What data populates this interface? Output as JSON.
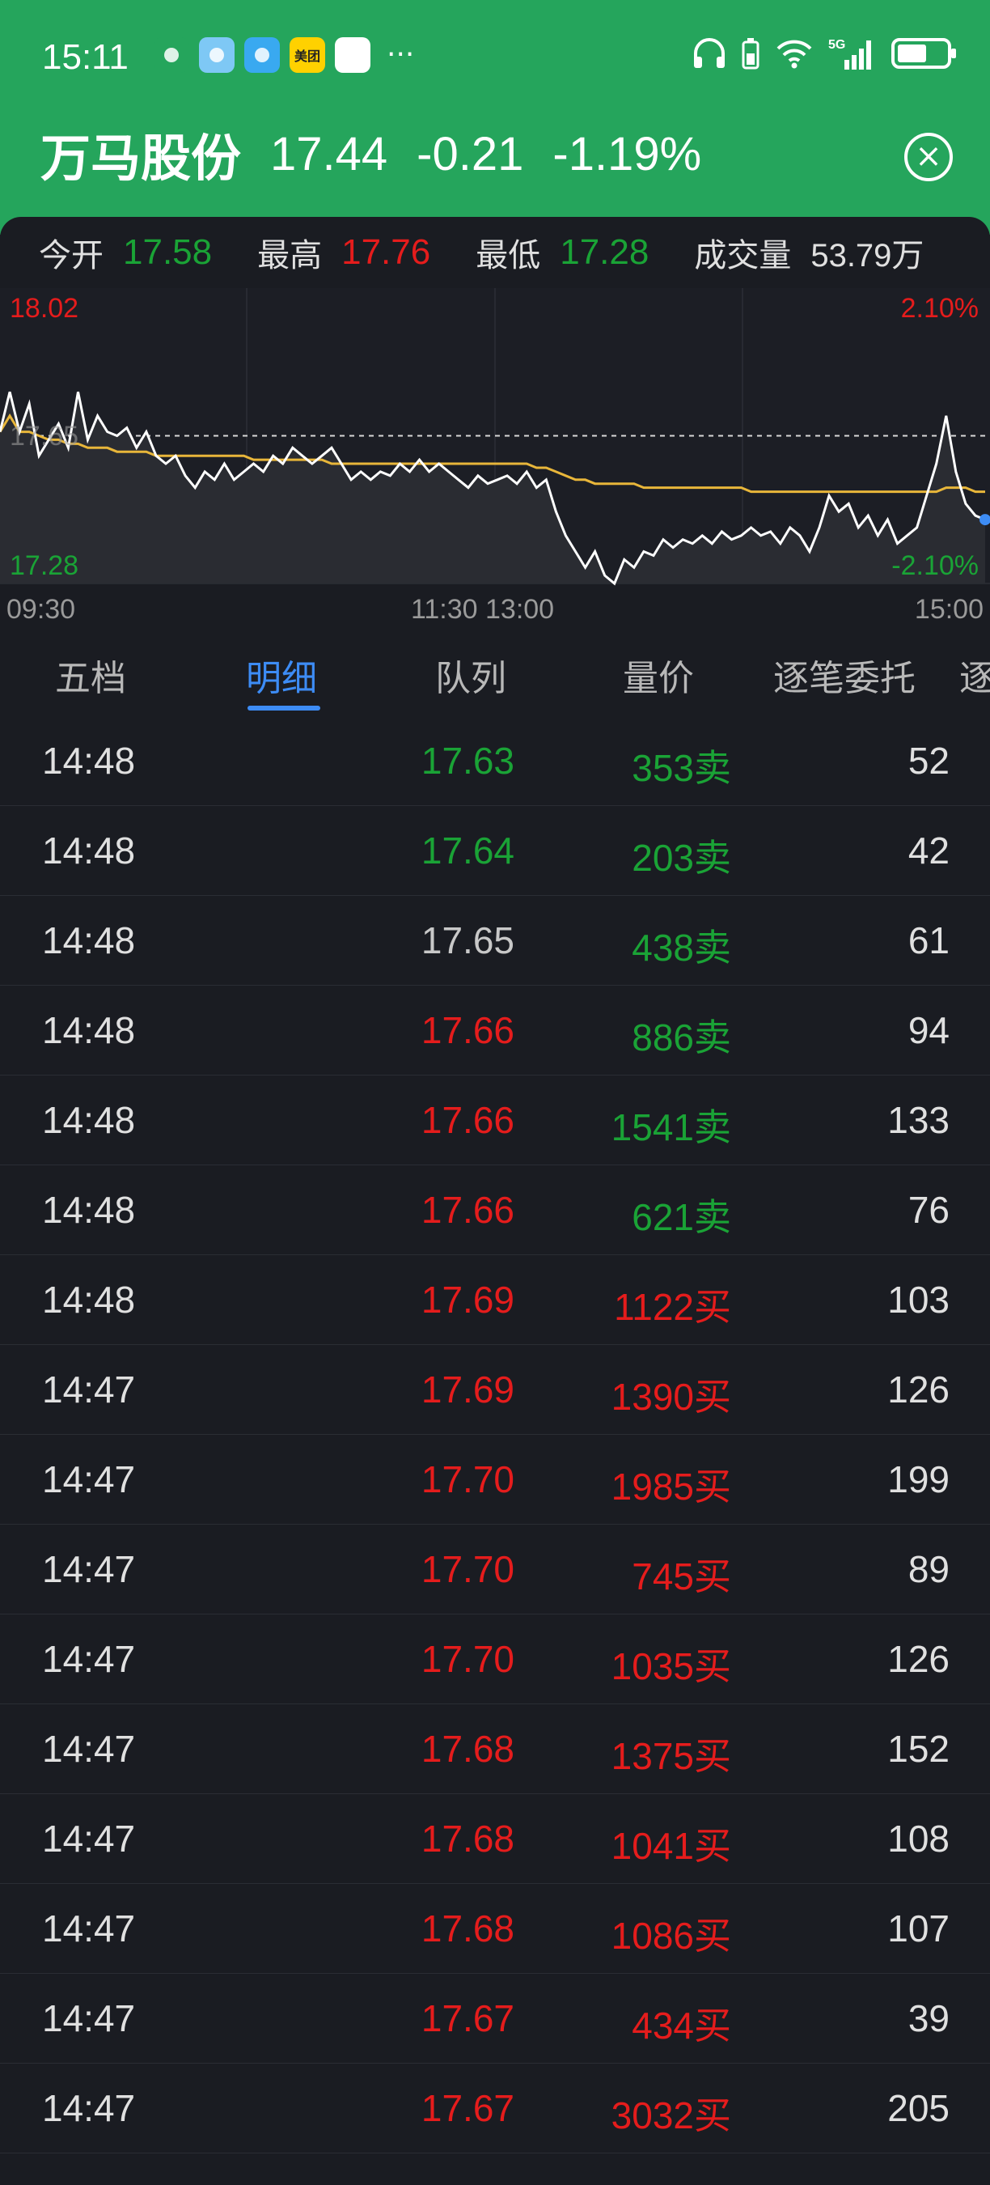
{
  "status": {
    "time": "15:11",
    "dots": "···",
    "network": "5G",
    "apps": [
      {
        "name": "wechat-icon",
        "label": "",
        "color": "#25a55c"
      },
      {
        "name": "weather-icon",
        "label": "",
        "color": "#7ec8f5"
      },
      {
        "name": "book-icon",
        "label": "",
        "color": "#39a9f0"
      },
      {
        "name": "meituan-icon",
        "label": "美团",
        "color": "#ffd100"
      },
      {
        "name": "browser-icon",
        "label": "",
        "color": "#ffffff"
      }
    ]
  },
  "stock": {
    "name": "万马股份",
    "price": "17.44",
    "change": "-0.21",
    "pct": "-1.19%"
  },
  "stats": {
    "open_label": "今开",
    "open": "17.58",
    "high_label": "最高",
    "high": "17.76",
    "low_label": "最低",
    "low": "17.28",
    "vol_label": "成交量",
    "vol": "53.79万"
  },
  "chart_data": {
    "type": "line",
    "y_max_label": "18.02",
    "y_min_label": "17.28",
    "y_mid_label": "17.65",
    "pct_max_label": "2.10%",
    "pct_min_label": "-2.10%",
    "x_labels": [
      "09:30",
      "11:30 13:00",
      "15:00"
    ],
    "ylim": [
      17.28,
      18.02
    ],
    "reference": 17.65,
    "series": [
      {
        "values": [
          17.66,
          17.76,
          17.66,
          17.73,
          17.6,
          17.64,
          17.68,
          17.62,
          17.76,
          17.64,
          17.7,
          17.66,
          17.65,
          17.67,
          17.62,
          17.66,
          17.6,
          17.58,
          17.6,
          17.55,
          17.52,
          17.56,
          17.54,
          17.58,
          17.54,
          17.56,
          17.58,
          17.56,
          17.6,
          17.58,
          17.62,
          17.6,
          17.58,
          17.6,
          17.62,
          17.58,
          17.54,
          17.56,
          17.54,
          17.56,
          17.55,
          17.58,
          17.56,
          17.59,
          17.56,
          17.58,
          17.56,
          17.54,
          17.52,
          17.55,
          17.53,
          17.54,
          17.55,
          17.53,
          17.56,
          17.52,
          17.54,
          17.46,
          17.4,
          17.36,
          17.32,
          17.36,
          17.3,
          17.28,
          17.34,
          17.32,
          17.36,
          17.35,
          17.39,
          17.37,
          17.39,
          17.38,
          17.4,
          17.38,
          17.41,
          17.39,
          17.4,
          17.42,
          17.4,
          17.41,
          17.38,
          17.42,
          17.4,
          17.36,
          17.42,
          17.5,
          17.46,
          17.48,
          17.42,
          17.45,
          17.4,
          17.44,
          17.38,
          17.4,
          17.42,
          17.5,
          17.58,
          17.7,
          17.56,
          17.48,
          17.45,
          17.44
        ]
      },
      {
        "values": [
          17.66,
          17.7,
          17.66,
          17.66,
          17.65,
          17.64,
          17.64,
          17.63,
          17.63,
          17.62,
          17.62,
          17.62,
          17.61,
          17.61,
          17.61,
          17.61,
          17.6,
          17.6,
          17.6,
          17.6,
          17.6,
          17.6,
          17.6,
          17.6,
          17.6,
          17.6,
          17.59,
          17.59,
          17.59,
          17.59,
          17.59,
          17.59,
          17.59,
          17.59,
          17.58,
          17.58,
          17.58,
          17.58,
          17.58,
          17.58,
          17.58,
          17.58,
          17.58,
          17.58,
          17.58,
          17.58,
          17.58,
          17.58,
          17.58,
          17.58,
          17.58,
          17.58,
          17.58,
          17.58,
          17.58,
          17.57,
          17.57,
          17.56,
          17.55,
          17.54,
          17.54,
          17.53,
          17.53,
          17.53,
          17.53,
          17.53,
          17.52,
          17.52,
          17.52,
          17.52,
          17.52,
          17.52,
          17.52,
          17.52,
          17.52,
          17.52,
          17.52,
          17.51,
          17.51,
          17.51,
          17.51,
          17.51,
          17.51,
          17.51,
          17.51,
          17.51,
          17.51,
          17.51,
          17.51,
          17.51,
          17.51,
          17.51,
          17.51,
          17.51,
          17.51,
          17.51,
          17.51,
          17.52,
          17.52,
          17.52,
          17.51,
          17.51
        ]
      }
    ]
  },
  "tabs": [
    "五档",
    "明细",
    "队列",
    "量价",
    "逐笔委托",
    "逐"
  ],
  "active_tab": 1,
  "trades": [
    {
      "time": "14:48",
      "price": "17.63",
      "pc": "green",
      "vol": "353卖",
      "vc": "green",
      "count": "52"
    },
    {
      "time": "14:48",
      "price": "17.64",
      "pc": "green",
      "vol": "203卖",
      "vc": "green",
      "count": "42"
    },
    {
      "time": "14:48",
      "price": "17.65",
      "pc": "grey",
      "vol": "438卖",
      "vc": "green",
      "count": "61"
    },
    {
      "time": "14:48",
      "price": "17.66",
      "pc": "red",
      "vol": "886卖",
      "vc": "green",
      "count": "94"
    },
    {
      "time": "14:48",
      "price": "17.66",
      "pc": "red",
      "vol": "1541卖",
      "vc": "green",
      "count": "133"
    },
    {
      "time": "14:48",
      "price": "17.66",
      "pc": "red",
      "vol": "621卖",
      "vc": "green",
      "count": "76"
    },
    {
      "time": "14:48",
      "price": "17.69",
      "pc": "red",
      "vol": "1122买",
      "vc": "red",
      "count": "103"
    },
    {
      "time": "14:47",
      "price": "17.69",
      "pc": "red",
      "vol": "1390买",
      "vc": "red",
      "count": "126"
    },
    {
      "time": "14:47",
      "price": "17.70",
      "pc": "red",
      "vol": "1985买",
      "vc": "red",
      "count": "199"
    },
    {
      "time": "14:47",
      "price": "17.70",
      "pc": "red",
      "vol": "745买",
      "vc": "red",
      "count": "89"
    },
    {
      "time": "14:47",
      "price": "17.70",
      "pc": "red",
      "vol": "1035买",
      "vc": "red",
      "count": "126"
    },
    {
      "time": "14:47",
      "price": "17.68",
      "pc": "red",
      "vol": "1375买",
      "vc": "red",
      "count": "152"
    },
    {
      "time": "14:47",
      "price": "17.68",
      "pc": "red",
      "vol": "1041买",
      "vc": "red",
      "count": "108"
    },
    {
      "time": "14:47",
      "price": "17.68",
      "pc": "red",
      "vol": "1086买",
      "vc": "red",
      "count": "107"
    },
    {
      "time": "14:47",
      "price": "17.67",
      "pc": "red",
      "vol": "434买",
      "vc": "red",
      "count": "39"
    },
    {
      "time": "14:47",
      "price": "17.67",
      "pc": "red",
      "vol": "3032买",
      "vc": "red",
      "count": "205"
    }
  ],
  "colors": {
    "up": "#e51c1c",
    "down": "#1aa336",
    "header": "#25a55c",
    "accent": "#3d8cf5"
  }
}
